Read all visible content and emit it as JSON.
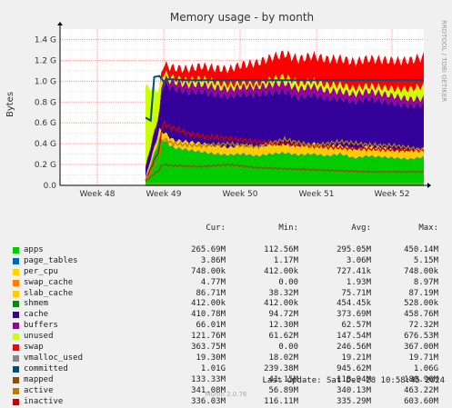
{
  "chart_data": {
    "type": "area",
    "title": "Memory usage - by month",
    "ylabel": "Bytes",
    "vertical_watermark": "RRDTOOL / TOBI OETIKER",
    "x_ticks": [
      "Week 48",
      "Week 49",
      "Week 50",
      "Week 51",
      "Week 52"
    ],
    "y_ticks": [
      "0.0",
      "0.2 G",
      "0.4 G",
      "0.6 G",
      "0.8 G",
      "1.0 G",
      "1.2 G",
      "1.4 G"
    ],
    "ylim": [
      0,
      1.5
    ],
    "y_unit": "G",
    "grid": true,
    "stacked_series": [
      {
        "name": "apps",
        "color": "#00cc00",
        "points": [
          [
            0.0,
            0.05
          ],
          [
            0.05,
            0.45
          ],
          [
            0.07,
            0.42
          ],
          [
            0.1,
            0.36
          ],
          [
            0.15,
            0.34
          ],
          [
            0.2,
            0.32
          ],
          [
            0.25,
            0.3
          ],
          [
            0.3,
            0.29
          ],
          [
            0.35,
            0.3
          ],
          [
            0.4,
            0.28
          ],
          [
            0.45,
            0.3
          ],
          [
            0.5,
            0.31
          ],
          [
            0.55,
            0.29
          ],
          [
            0.6,
            0.3
          ],
          [
            0.65,
            0.28
          ],
          [
            0.7,
            0.3
          ],
          [
            0.75,
            0.26
          ],
          [
            0.8,
            0.28
          ],
          [
            0.85,
            0.27
          ],
          [
            0.9,
            0.26
          ],
          [
            0.95,
            0.25
          ],
          [
            1.0,
            0.27
          ]
        ]
      },
      {
        "name": "page_tables",
        "color": "#0066b3",
        "points": [
          [
            0.0,
            0.004
          ],
          [
            1.0,
            0.004
          ]
        ]
      },
      {
        "name": "per_cpu",
        "color": "#ff8000",
        "points": [
          [
            0.0,
            0.001
          ],
          [
            1.0,
            0.001
          ]
        ]
      },
      {
        "name": "slab_cache",
        "color": "#ffcc00",
        "points": [
          [
            0.0,
            0.02
          ],
          [
            0.05,
            0.08
          ],
          [
            0.1,
            0.07
          ],
          [
            0.2,
            0.08
          ],
          [
            0.3,
            0.07
          ],
          [
            0.4,
            0.09
          ],
          [
            0.5,
            0.08
          ],
          [
            0.6,
            0.1
          ],
          [
            0.7,
            0.08
          ],
          [
            0.8,
            0.09
          ],
          [
            0.9,
            0.08
          ],
          [
            1.0,
            0.08
          ]
        ]
      },
      {
        "name": "cache",
        "color": "#330099",
        "points": [
          [
            0.0,
            0.1
          ],
          [
            0.05,
            0.15
          ],
          [
            0.06,
            0.45
          ],
          [
            0.1,
            0.5
          ],
          [
            0.15,
            0.48
          ],
          [
            0.2,
            0.5
          ],
          [
            0.3,
            0.49
          ],
          [
            0.4,
            0.5
          ],
          [
            0.5,
            0.51
          ],
          [
            0.55,
            0.46
          ],
          [
            0.6,
            0.47
          ],
          [
            0.7,
            0.45
          ],
          [
            0.8,
            0.46
          ],
          [
            0.9,
            0.44
          ],
          [
            1.0,
            0.42
          ]
        ]
      },
      {
        "name": "buffers",
        "color": "#990099",
        "points": [
          [
            0.0,
            0.01
          ],
          [
            0.05,
            0.03
          ],
          [
            0.06,
            0.06
          ],
          [
            0.2,
            0.07
          ],
          [
            0.4,
            0.07
          ],
          [
            0.5,
            0.08
          ],
          [
            0.6,
            0.08
          ],
          [
            0.7,
            0.07
          ],
          [
            0.8,
            0.07
          ],
          [
            0.9,
            0.07
          ],
          [
            1.0,
            0.06
          ]
        ]
      },
      {
        "name": "unused",
        "color": "#ccff00",
        "points": [
          [
            0.0,
            0.76
          ],
          [
            0.05,
            0.2
          ],
          [
            0.06,
            0.05
          ],
          [
            0.1,
            0.03
          ],
          [
            0.2,
            0.05
          ],
          [
            0.3,
            0.04
          ],
          [
            0.4,
            0.03
          ],
          [
            0.5,
            0.06
          ],
          [
            0.6,
            0.05
          ],
          [
            0.7,
            0.06
          ],
          [
            0.8,
            0.05
          ],
          [
            0.9,
            0.07
          ],
          [
            1.0,
            0.12
          ]
        ]
      },
      {
        "name": "swap",
        "color": "#ff0000",
        "points": [
          [
            0.0,
            0.0
          ],
          [
            0.05,
            0.0
          ],
          [
            0.06,
            0.08
          ],
          [
            0.1,
            0.1
          ],
          [
            0.2,
            0.12
          ],
          [
            0.3,
            0.15
          ],
          [
            0.4,
            0.2
          ],
          [
            0.5,
            0.22
          ],
          [
            0.6,
            0.24
          ],
          [
            0.7,
            0.25
          ],
          [
            0.8,
            0.26
          ],
          [
            0.9,
            0.27
          ],
          [
            1.0,
            0.28
          ]
        ]
      }
    ],
    "line_series": [
      {
        "name": "committed",
        "color": "#004d80",
        "points": [
          [
            0.0,
            0.65
          ],
          [
            0.02,
            0.62
          ],
          [
            0.03,
            1.04
          ],
          [
            0.05,
            1.05
          ],
          [
            0.07,
            0.98
          ],
          [
            0.08,
            1.02
          ],
          [
            0.15,
            1.01
          ],
          [
            0.25,
            1.01
          ],
          [
            0.5,
            1.01
          ],
          [
            0.75,
            1.01
          ],
          [
            1.0,
            1.01
          ]
        ]
      },
      {
        "name": "inactive",
        "color": "#cc0000",
        "points": [
          [
            0.0,
            0.05
          ],
          [
            0.05,
            0.35
          ],
          [
            0.06,
            0.6
          ],
          [
            0.1,
            0.55
          ],
          [
            0.15,
            0.5
          ],
          [
            0.2,
            0.47
          ],
          [
            0.3,
            0.45
          ],
          [
            0.4,
            0.42
          ],
          [
            0.5,
            0.4
          ],
          [
            0.6,
            0.38
          ],
          [
            0.7,
            0.36
          ],
          [
            0.8,
            0.35
          ],
          [
            0.9,
            0.34
          ],
          [
            1.0,
            0.34
          ]
        ]
      },
      {
        "name": "active",
        "color": "#b38000",
        "points": [
          [
            0.0,
            0.05
          ],
          [
            0.05,
            0.25
          ],
          [
            0.06,
            0.45
          ],
          [
            0.1,
            0.4
          ],
          [
            0.2,
            0.38
          ],
          [
            0.3,
            0.4
          ],
          [
            0.4,
            0.37
          ],
          [
            0.5,
            0.44
          ],
          [
            0.6,
            0.38
          ],
          [
            0.7,
            0.42
          ],
          [
            0.8,
            0.39
          ],
          [
            0.9,
            0.38
          ],
          [
            1.0,
            0.34
          ]
        ]
      },
      {
        "name": "mapped",
        "color": "#8f4d00",
        "points": [
          [
            0.0,
            0.04
          ],
          [
            0.05,
            0.15
          ],
          [
            0.06,
            0.2
          ],
          [
            0.1,
            0.19
          ],
          [
            0.2,
            0.18
          ],
          [
            0.3,
            0.2
          ],
          [
            0.4,
            0.17
          ],
          [
            0.5,
            0.16
          ],
          [
            0.6,
            0.15
          ],
          [
            0.7,
            0.14
          ],
          [
            0.8,
            0.13
          ],
          [
            0.9,
            0.13
          ],
          [
            1.0,
            0.13
          ]
        ]
      },
      {
        "name": "vmalloc_used",
        "color": "#888888",
        "points": [
          [
            0.0,
            0.02
          ],
          [
            1.0,
            0.02
          ]
        ]
      },
      {
        "name": "shmem",
        "color": "#008f00",
        "points": [
          [
            0.0,
            0.0004
          ],
          [
            1.0,
            0.0004
          ]
        ]
      },
      {
        "name": "swap_cache",
        "color": "#ff8000",
        "points": [
          [
            0.0,
            0.005
          ],
          [
            1.0,
            0.005
          ]
        ]
      }
    ]
  },
  "legend": {
    "headers": {
      "cur": "Cur:",
      "min": "Min:",
      "avg": "Avg:",
      "max": "Max:"
    },
    "rows": [
      {
        "name": "apps",
        "color": "#00cc00",
        "cur": "265.69M",
        "min": "112.56M",
        "avg": "295.05M",
        "max": "450.14M"
      },
      {
        "name": "page_tables",
        "color": "#0066b3",
        "cur": "3.86M",
        "min": "1.17M",
        "avg": "3.06M",
        "max": "5.15M"
      },
      {
        "name": "per_cpu",
        "color": "#ffd300",
        "cur": "748.00k",
        "min": "412.00k",
        "avg": "727.41k",
        "max": "748.00k"
      },
      {
        "name": "swap_cache",
        "color": "#ff8000",
        "cur": "4.77M",
        "min": "0.00",
        "avg": "1.93M",
        "max": "8.97M"
      },
      {
        "name": "slab_cache",
        "color": "#ffcc00",
        "cur": "86.71M",
        "min": "38.32M",
        "avg": "75.71M",
        "max": "87.19M"
      },
      {
        "name": "shmem",
        "color": "#008f00",
        "cur": "412.00k",
        "min": "412.00k",
        "avg": "454.45k",
        "max": "528.00k"
      },
      {
        "name": "cache",
        "color": "#330099",
        "cur": "410.78M",
        "min": "94.72M",
        "avg": "373.69M",
        "max": "458.76M"
      },
      {
        "name": "buffers",
        "color": "#990099",
        "cur": "66.01M",
        "min": "12.30M",
        "avg": "62.57M",
        "max": "72.32M"
      },
      {
        "name": "unused",
        "color": "#ccff00",
        "cur": "121.76M",
        "min": "61.62M",
        "avg": "147.54M",
        "max": "676.53M"
      },
      {
        "name": "swap",
        "color": "#ff0000",
        "cur": "363.75M",
        "min": "0.00",
        "avg": "246.56M",
        "max": "367.00M"
      },
      {
        "name": "vmalloc_used",
        "color": "#888888",
        "cur": "19.30M",
        "min": "18.02M",
        "avg": "19.21M",
        "max": "19.71M"
      },
      {
        "name": "committed",
        "color": "#004d80",
        "cur": "1.01G",
        "min": "239.38M",
        "avg": "945.62M",
        "max": "1.06G"
      },
      {
        "name": "mapped",
        "color": "#8f4d00",
        "cur": "133.33M",
        "min": "41.15M",
        "avg": "118.94M",
        "max": "180.96M"
      },
      {
        "name": "active",
        "color": "#b38000",
        "cur": "341.08M",
        "min": "56.89M",
        "avg": "340.13M",
        "max": "463.22M"
      },
      {
        "name": "inactive",
        "color": "#cc0000",
        "cur": "336.03M",
        "min": "116.11M",
        "avg": "335.29M",
        "max": "603.60M"
      }
    ]
  },
  "footer": {
    "last_update": "Last update: Sat Dec 28 10:58:45 2024",
    "munin": "Munin 2.0.76"
  }
}
